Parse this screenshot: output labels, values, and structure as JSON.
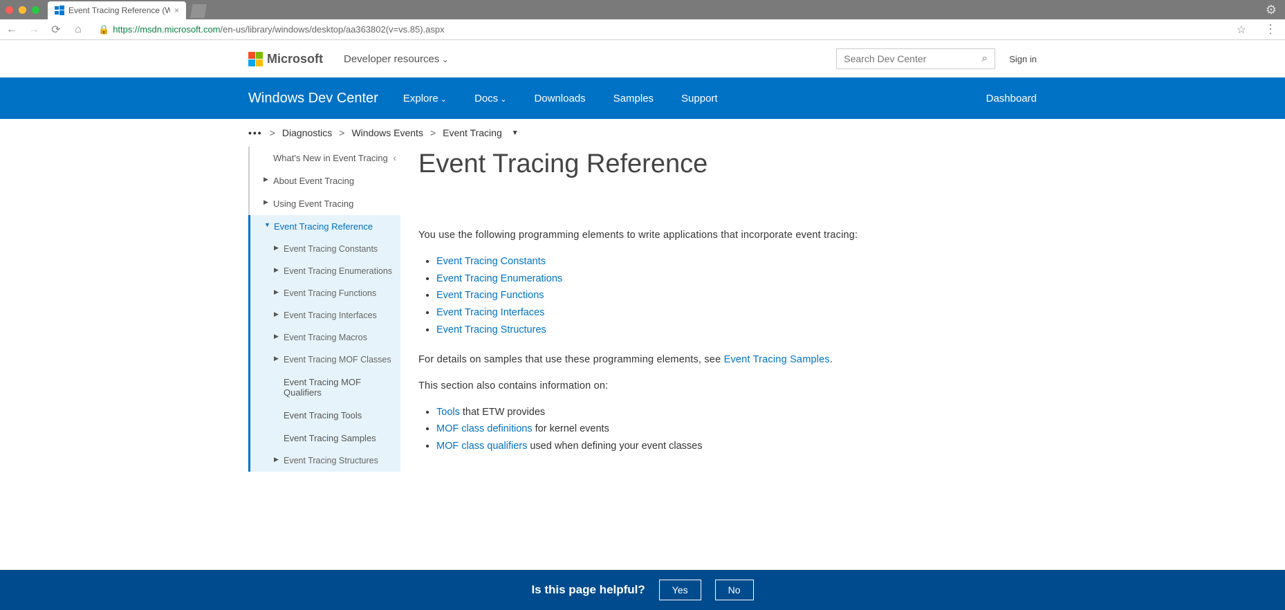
{
  "browser": {
    "tab_title": "Event Tracing Reference (Wind",
    "url_scheme": "https",
    "url_host": "://msdn.microsoft.com",
    "url_path": "/en-us/library/windows/desktop/aa363802(v=vs.85).aspx"
  },
  "header": {
    "logo_text": "Microsoft",
    "dev_resources": "Developer resources",
    "search_placeholder": "Search Dev Center",
    "signin": "Sign in"
  },
  "bluenav": {
    "site_title": "Windows Dev Center",
    "items": [
      "Explore",
      "Docs",
      "Downloads",
      "Samples",
      "Support"
    ],
    "dashboard": "Dashboard"
  },
  "breadcrumb": {
    "dots": "•••",
    "items": [
      "Diagnostics",
      "Windows Events",
      "Event Tracing"
    ]
  },
  "sidebar": {
    "top": [
      "What's New in Event Tracing",
      "About Event Tracing",
      "Using Event Tracing"
    ],
    "active_group_label": "Event Tracing Reference",
    "subs": [
      "Event Tracing Constants",
      "Event Tracing Enumerations",
      "Event Tracing Functions",
      "Event Tracing Interfaces",
      "Event Tracing Macros",
      "Event Tracing MOF Classes"
    ],
    "subsubs": [
      "Event Tracing MOF Qualifiers",
      "Event Tracing Tools",
      "Event Tracing Samples"
    ],
    "tail": [
      "Event Tracing Structures"
    ]
  },
  "content": {
    "title": "Event Tracing Reference",
    "intro": "You use the following programming elements to write applications that incorporate event tracing:",
    "list1": [
      "Event Tracing Constants",
      "Event Tracing Enumerations",
      "Event Tracing Functions",
      "Event Tracing Interfaces",
      "Event Tracing Structures"
    ],
    "para2_pre": "For details on samples that use these programming elements, see ",
    "para2_link": "Event Tracing Samples",
    "para2_post": ".",
    "para3": "This section also contains information on:",
    "list2": [
      {
        "link": "Tools",
        "rest": " that ETW provides"
      },
      {
        "link": "MOF class definitions",
        "rest": " for kernel events"
      },
      {
        "link": "MOF class qualifiers",
        "rest": " used when defining your event classes"
      }
    ]
  },
  "feedback": {
    "question": "Is this page helpful?",
    "yes": "Yes",
    "no": "No"
  }
}
